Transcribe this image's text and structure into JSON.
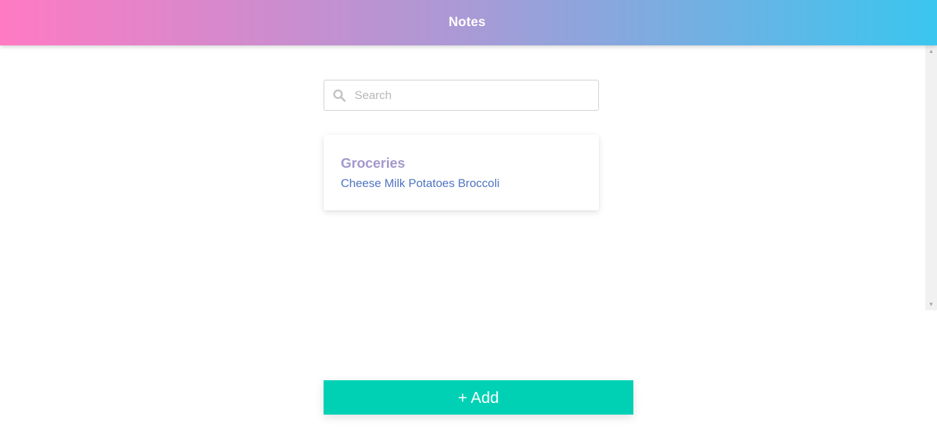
{
  "header": {
    "title": "Notes",
    "gradient_start": "#ff7ac3",
    "gradient_end": "#3ac6ef"
  },
  "search": {
    "placeholder": "Search",
    "value": "",
    "icon": "search-icon"
  },
  "notes": [
    {
      "title": "Groceries",
      "body": "Cheese Milk Potatoes Broccoli"
    }
  ],
  "add_button": {
    "label": "+ Add",
    "color": "#00d1b5"
  },
  "scrollbar": {
    "up_icon": "scroll-up-arrow-icon",
    "down_icon": "scroll-down-arrow-icon"
  }
}
